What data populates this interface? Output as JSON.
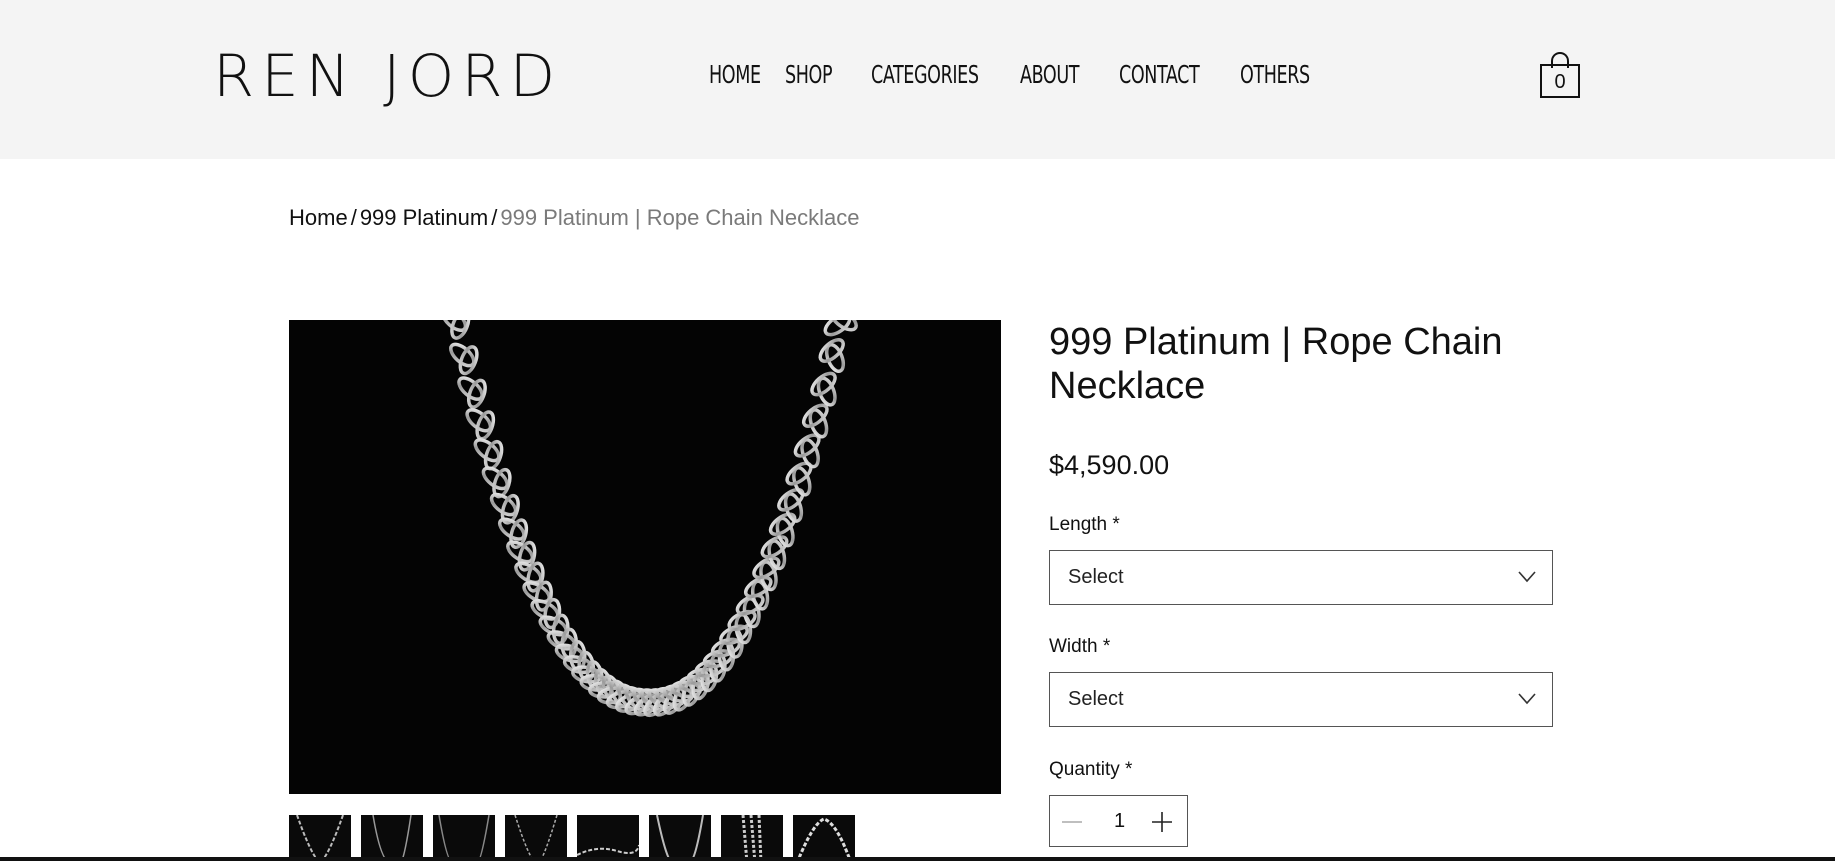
{
  "header": {
    "logo": "REN JORD",
    "nav": [
      "HOME",
      "SHOP",
      "CATEGORIES",
      "ABOUT",
      "CONTACT",
      "OTHERS"
    ],
    "cart_count": "0",
    "cart_icon": "shopping-bag-icon"
  },
  "breadcrumb": {
    "home": "Home",
    "separator": "/",
    "category": "999 Platinum",
    "current": "999 Platinum | Rope Chain Necklace"
  },
  "product": {
    "title": "999 Platinum | Rope Chain Necklace",
    "price": "$4,590.00",
    "length": {
      "label": "Length *",
      "value": "Select"
    },
    "width": {
      "label": "Width *",
      "value": "Select"
    },
    "quantity": {
      "label": "Quantity *",
      "value": "1"
    }
  },
  "gallery": {
    "thumbnail_count": 8
  },
  "colors": {
    "header_bg": "#f4f4f4",
    "image_bg": "#040404",
    "breadcrumb_current": "#7a7a7a"
  }
}
